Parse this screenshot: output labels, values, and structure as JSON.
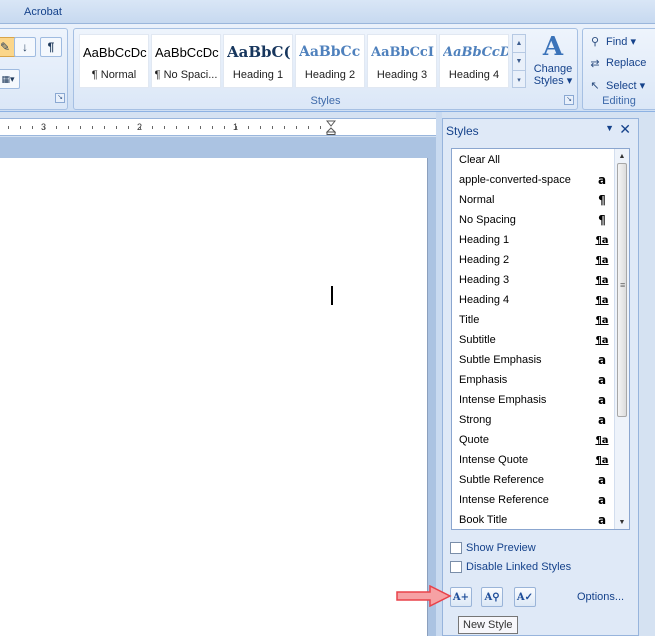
{
  "tabs": {
    "acrobat": "Acrobat"
  },
  "ribbon": {
    "styles_gallery": [
      {
        "sample": "AaBbCcDc",
        "label": "¶ Normal",
        "variant": "normal"
      },
      {
        "sample": "AaBbCcDc",
        "label": "¶ No Spaci...",
        "variant": "normal"
      },
      {
        "sample": "AaBbC(",
        "label": "Heading 1",
        "variant": "h1"
      },
      {
        "sample": "AaBbCc",
        "label": "Heading 2",
        "variant": "h2"
      },
      {
        "sample": "AaBbCcI",
        "label": "Heading 3",
        "variant": "h3"
      },
      {
        "sample": "AaBbCcD",
        "label": "Heading 4",
        "variant": "h4"
      }
    ],
    "change_styles": {
      "line1": "Change",
      "line2": "Styles ▾"
    },
    "styles_group_label": "Styles",
    "editing": {
      "find": "Find ▾",
      "replace": "Replace",
      "select": "Select ▾",
      "group_label": "Editing"
    }
  },
  "ruler": {
    "numbers": [
      "3",
      "2",
      "1"
    ]
  },
  "styles_pane": {
    "title": "Styles",
    "items": [
      {
        "name": "Clear All",
        "indicator": "",
        "type": "none"
      },
      {
        "name": "apple-converted-space",
        "indicator": "a",
        "type": "char"
      },
      {
        "name": "Normal",
        "indicator": "¶",
        "type": "para"
      },
      {
        "name": "No Spacing",
        "indicator": "¶",
        "type": "para"
      },
      {
        "name": "Heading 1",
        "indicator": "¶a",
        "type": "link"
      },
      {
        "name": "Heading 2",
        "indicator": "¶a",
        "type": "link"
      },
      {
        "name": "Heading 3",
        "indicator": "¶a",
        "type": "link"
      },
      {
        "name": "Heading 4",
        "indicator": "¶a",
        "type": "link"
      },
      {
        "name": "Title",
        "indicator": "¶a",
        "type": "link"
      },
      {
        "name": "Subtitle",
        "indicator": "¶a",
        "type": "link"
      },
      {
        "name": "Subtle Emphasis",
        "indicator": "a",
        "type": "char"
      },
      {
        "name": "Emphasis",
        "indicator": "a",
        "type": "char"
      },
      {
        "name": "Intense Emphasis",
        "indicator": "a",
        "type": "char"
      },
      {
        "name": "Strong",
        "indicator": "a",
        "type": "char"
      },
      {
        "name": "Quote",
        "indicator": "¶a",
        "type": "link"
      },
      {
        "name": "Intense Quote",
        "indicator": "¶a",
        "type": "link"
      },
      {
        "name": "Subtle Reference",
        "indicator": "a",
        "type": "char"
      },
      {
        "name": "Intense Reference",
        "indicator": "a",
        "type": "char"
      },
      {
        "name": "Book Title",
        "indicator": "a",
        "type": "char"
      }
    ],
    "show_preview": {
      "label": "Show Preview",
      "checked": false
    },
    "disable_linked": {
      "label": "Disable Linked Styles",
      "checked": false
    },
    "options": "Options...",
    "tooltip": "New Style"
  },
  "colors": {
    "ribbon_text": "#15428b",
    "arrow": "#e8424a"
  }
}
